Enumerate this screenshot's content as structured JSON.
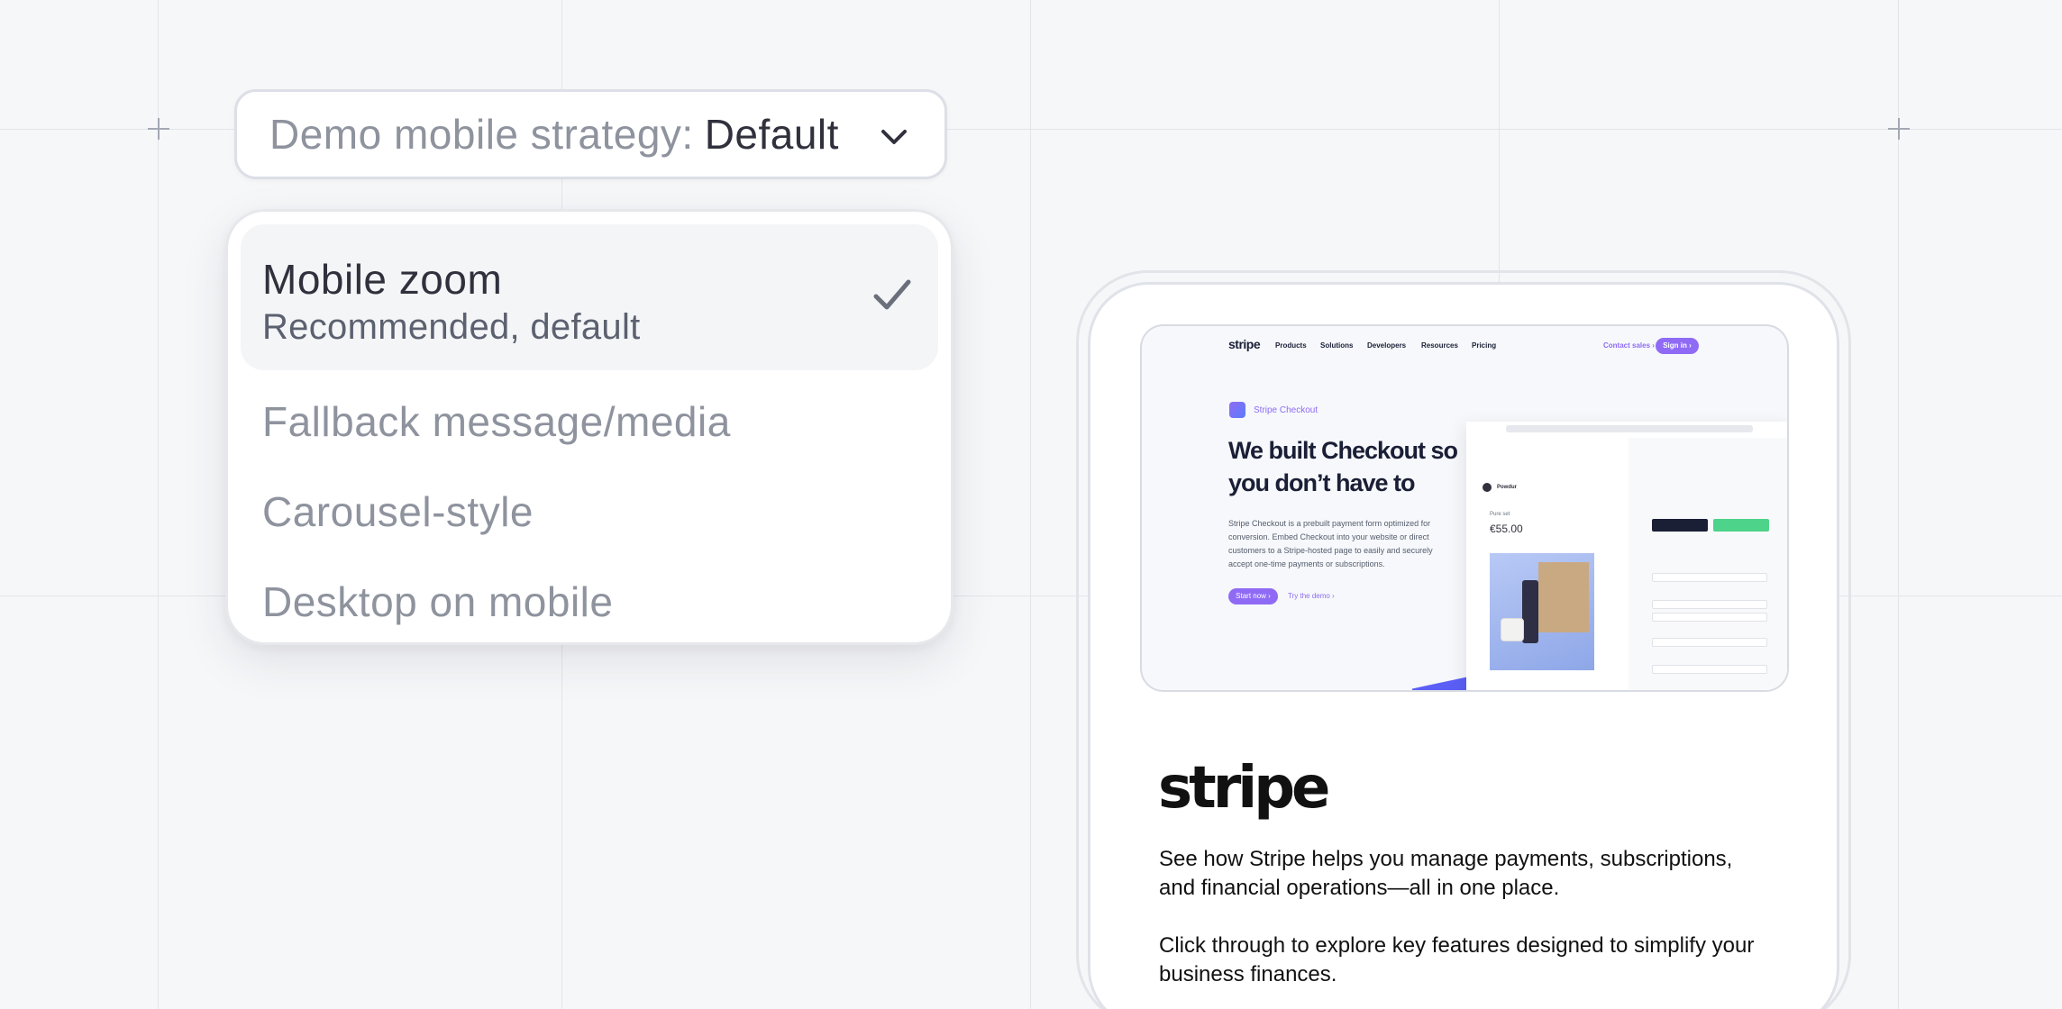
{
  "selector": {
    "prefix": "Demo mobile strategy:",
    "value": "Default"
  },
  "options": [
    {
      "title": "Mobile zoom",
      "subtitle": "Recommended, default",
      "selected": true
    },
    {
      "title": "Fallback message/media",
      "selected": false
    },
    {
      "title": "Carousel-style",
      "selected": false
    },
    {
      "title": "Desktop on mobile",
      "selected": false
    }
  ],
  "preview": {
    "nav": {
      "logo": "stripe",
      "links": [
        "Products",
        "Solutions",
        "Developers",
        "Resources",
        "Pricing"
      ],
      "contact": "Contact sales ›",
      "signin": "Sign in ›"
    },
    "badge": "Stripe Checkout",
    "hero": "We built Checkout so you don’t have to",
    "description": "Stripe Checkout is a prebuilt payment form optimized for conversion. Embed Checkout into your website or direct customers to a Stripe-hosted page to easily and securely accept one-time payments or subscriptions.",
    "start_button": "Start now ›",
    "try_demo": "Try the demo ›",
    "checkout": {
      "merchant": "Powdur",
      "label": "Pure set",
      "price": "€55.00"
    }
  },
  "brand": {
    "logo": "stripe",
    "paragraph1": "See how Stripe helps you manage payments, subscriptions, and financial operations—all in one place.",
    "paragraph2": " Click through to explore key features designed to simplify your business finances."
  },
  "colors": {
    "background": "#f6f7f9",
    "accent": "#8f6bf5",
    "text": "#30313d",
    "muted": "#8e939e"
  }
}
